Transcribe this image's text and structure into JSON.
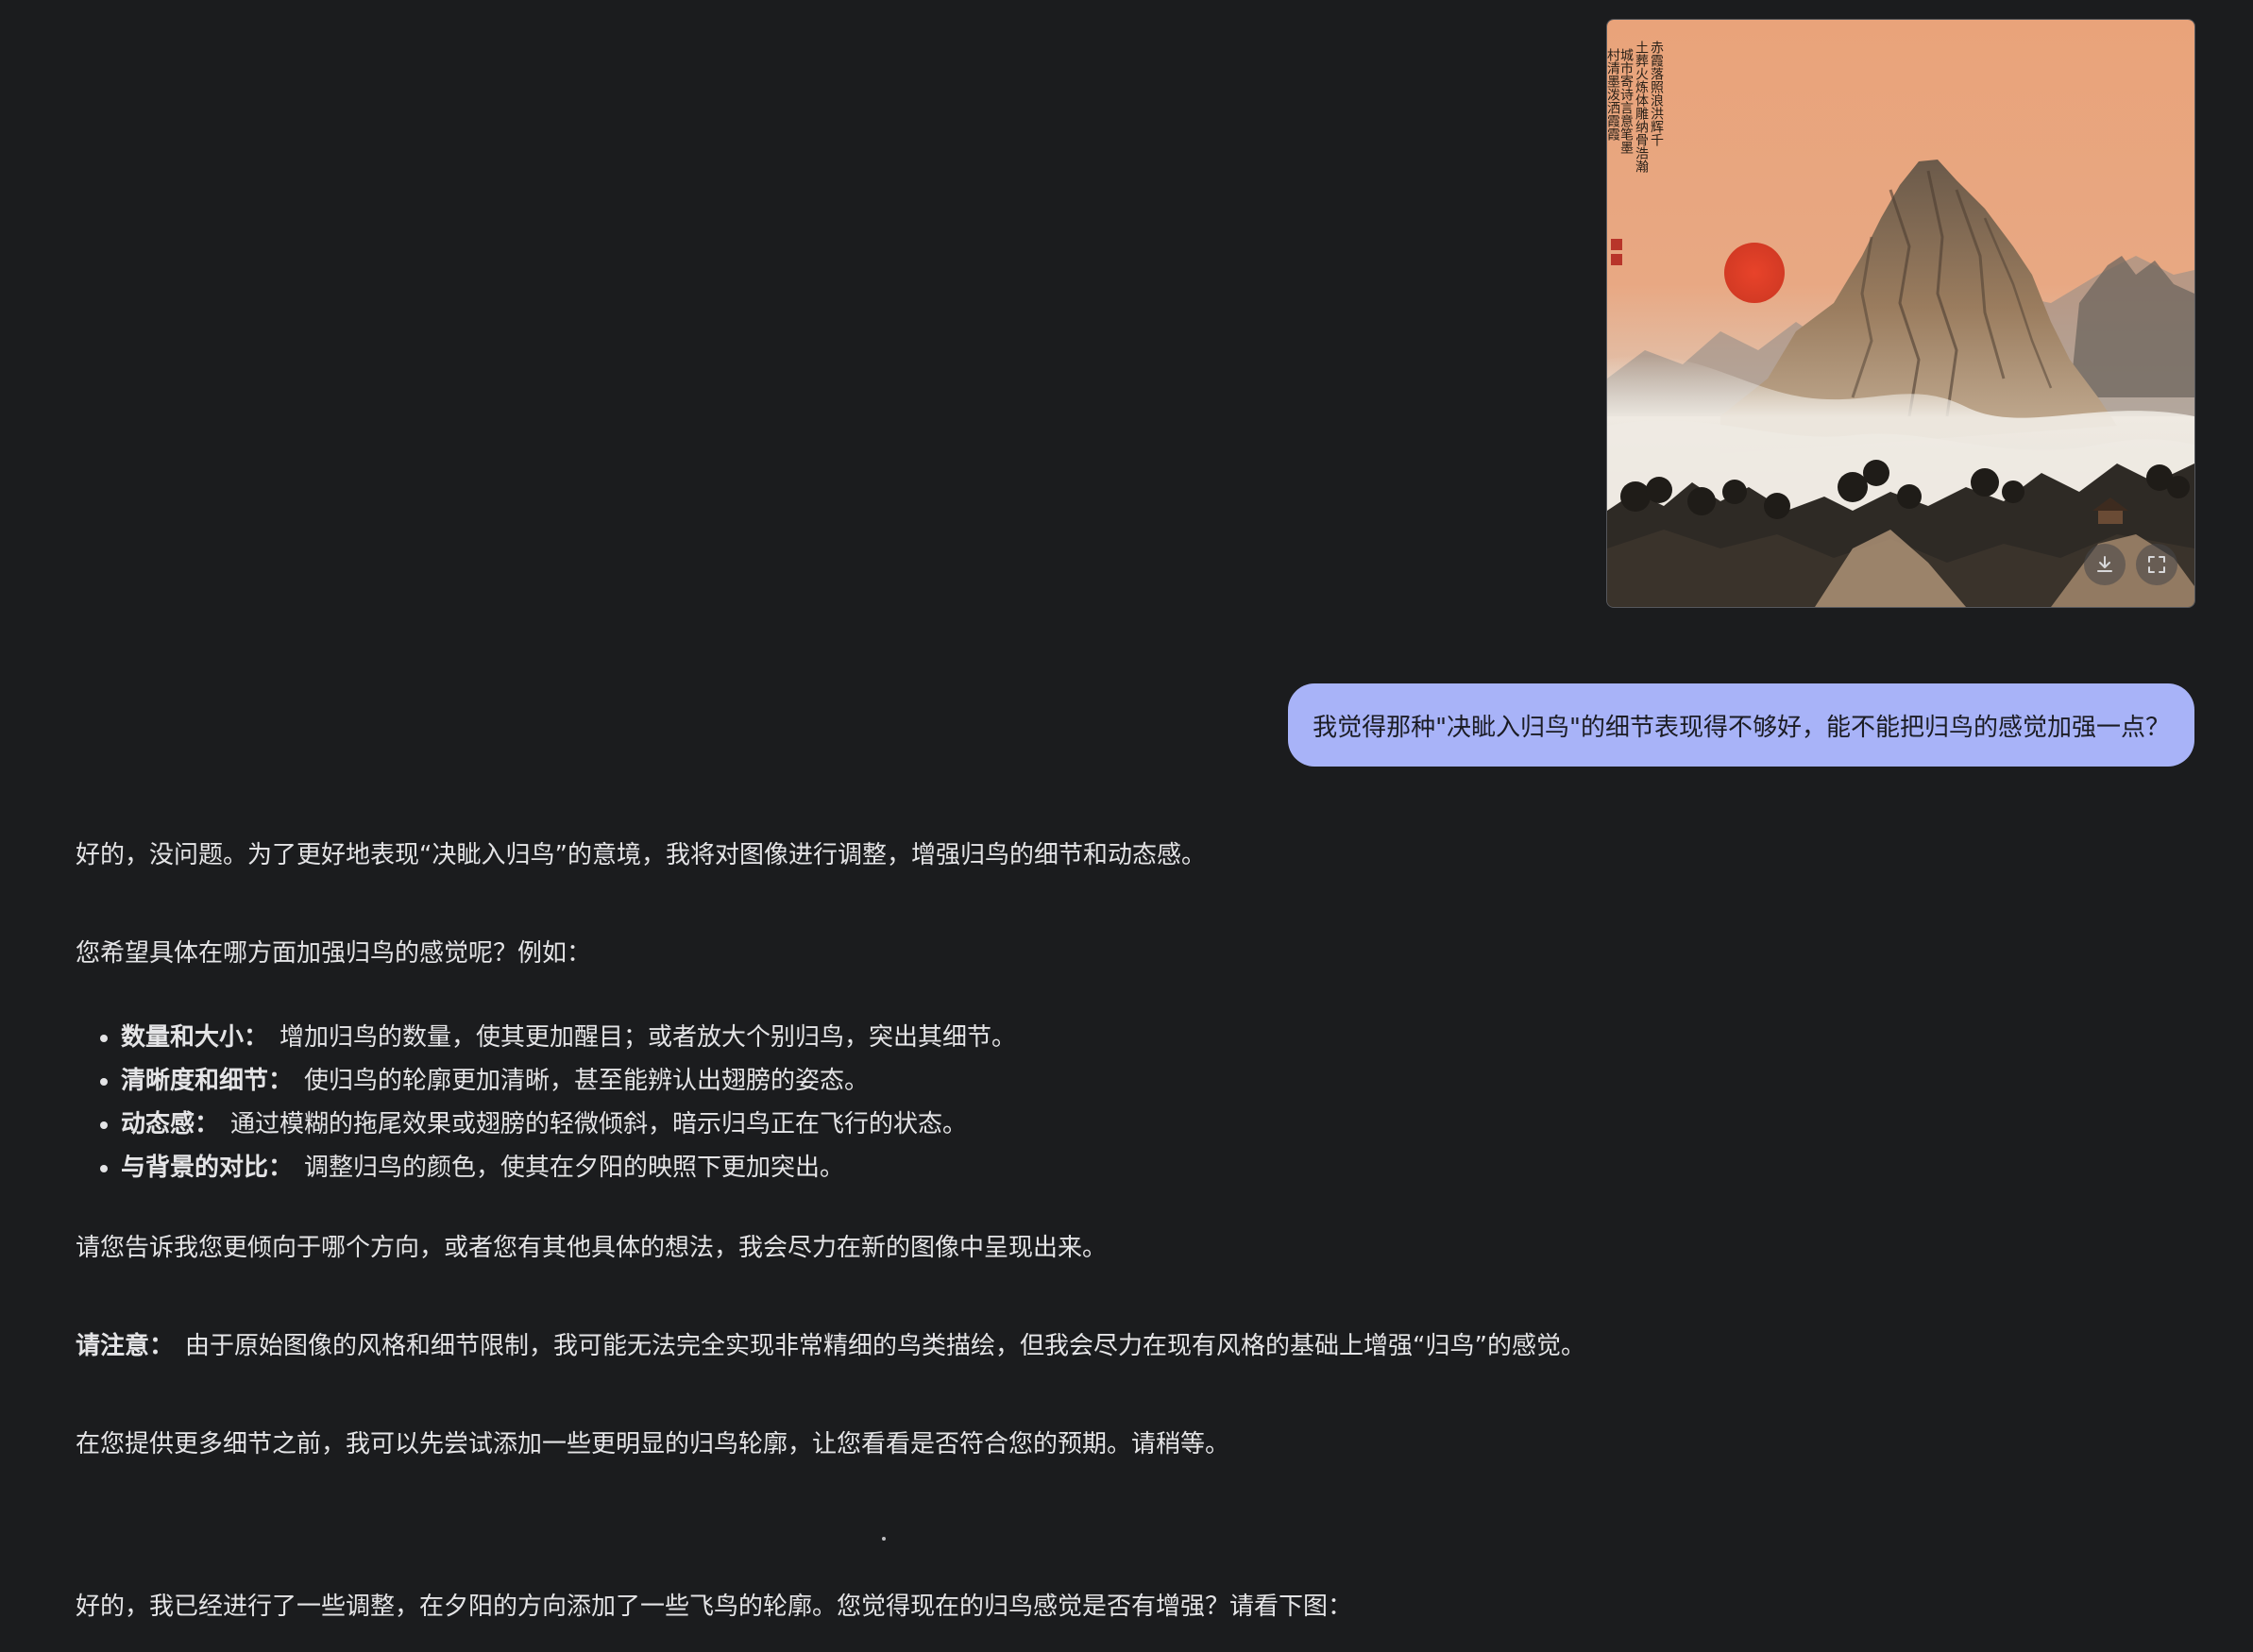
{
  "user_image": {
    "calligraphy_columns": [
      "赤霞落照浪洪辉千",
      "土葬火炼体雕纳骨浩瀚",
      "城市寄诗言意笔墨",
      "村清墨泼洒霞霞"
    ],
    "actions": {
      "download_icon": "download-icon",
      "expand_icon": "fullscreen-icon"
    }
  },
  "user_message": {
    "text": "我觉得那种\"决眦入归鸟\"的细节表现得不够好，能不能把归鸟的感觉加强一点？"
  },
  "response": {
    "intro": "好的，没问题。为了更好地表现“决眦入归鸟”的意境，我将对图像进行调整，增强归鸟的细节和动态感。",
    "question": "您希望具体在哪方面加强归鸟的感觉呢？例如：",
    "options": [
      {
        "label": "数量和大小：",
        "text": "增加归鸟的数量，使其更加醒目；或者放大个别归鸟，突出其细节。"
      },
      {
        "label": "清晰度和细节：",
        "text": "使归鸟的轮廓更加清晰，甚至能辨认出翅膀的姿态。"
      },
      {
        "label": "动态感：",
        "text": "通过模糊的拖尾效果或翅膀的轻微倾斜，暗示归鸟正在飞行的状态。"
      },
      {
        "label": "与背景的对比：",
        "text": "调整归鸟的颜色，使其在夕阳的映照下更加突出。"
      }
    ],
    "ask_direction": "请您告诉我您更倾向于哪个方向，或者您有其他具体的想法，我会尽力在新的图像中呈现出来。",
    "note_label": "请注意：",
    "note_text": "由于原始图像的风格和细节限制，我可能无法完全实现非常精细的鸟类描绘，但我会尽力在现有风格的基础上增强“归鸟”的感觉。",
    "trial": "在您提供更多细节之前，我可以先尝试添加一些更明显的归鸟轮廓，让您看看是否符合您的预期。请稍等。",
    "result": "好的，我已经进行了一些调整，在夕阳的方向添加了一些飞鸟的轮廓。您觉得现在的归鸟感觉是否有增强？请看下图："
  },
  "colors": {
    "background": "#1b1c1e",
    "user_bubble": "#a8b3f8",
    "text": "#e4e4e6"
  }
}
